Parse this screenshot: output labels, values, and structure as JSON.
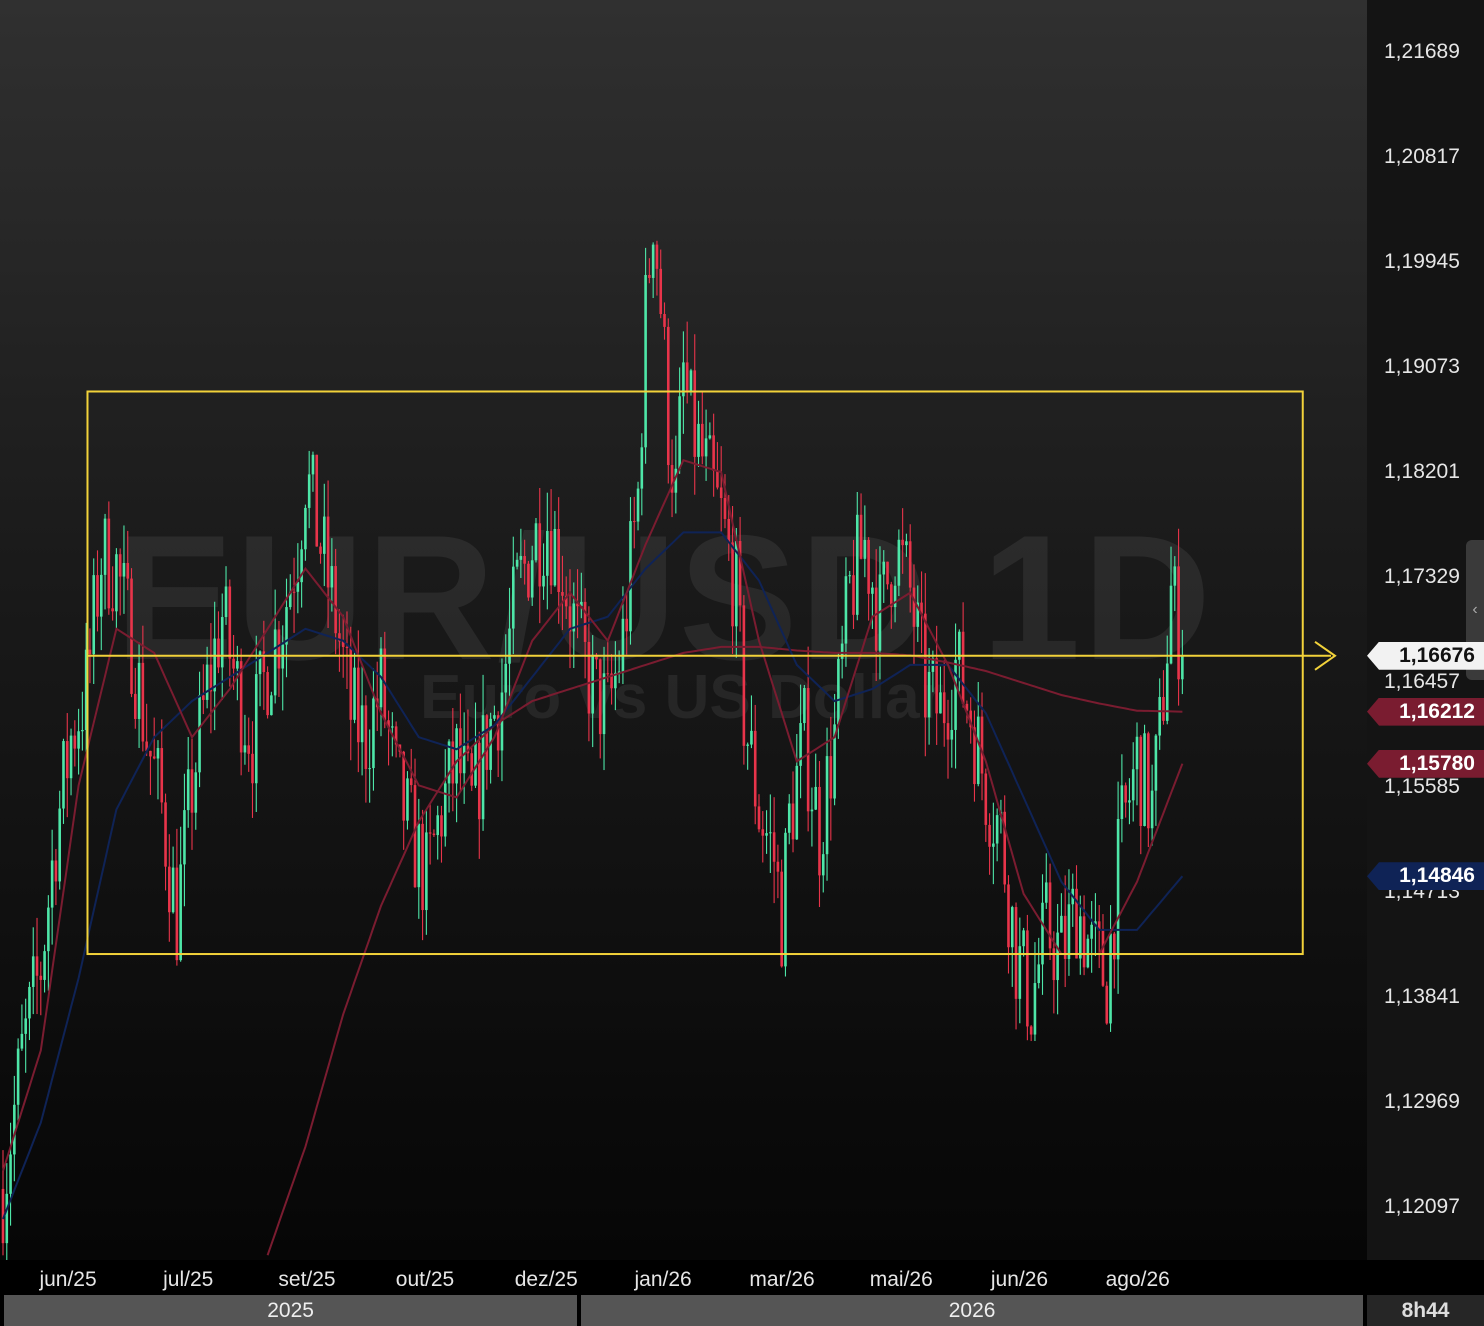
{
  "watermark": {
    "symbol": "EUR/USD 1D",
    "description": "Euro vs US Dollar"
  },
  "clock": "8h44",
  "colors": {
    "up": "#4ee6a8",
    "down": "#e8344a",
    "ma_fast": "#7a1c30",
    "ma_mid": "#0f2356",
    "ma_slow": "#7a1c30",
    "rectangle": "#f2d23a"
  },
  "chart_data": {
    "type": "candlestick",
    "timeframe": "1D",
    "ylim": [
      1.1166,
      1.2212
    ],
    "price_ticks": [
      "1,21689",
      "1,20817",
      "1,19945",
      "1,19073",
      "1,18201",
      "1,17329",
      "1,16457",
      "1,15585",
      "1,14713",
      "1,13841",
      "1,12969",
      "1,12097"
    ],
    "price_tick_values": [
      1.21689,
      1.20817,
      1.19945,
      1.19073,
      1.18201,
      1.17329,
      1.16457,
      1.15585,
      1.14713,
      1.13841,
      1.12969,
      1.12097
    ],
    "months": [
      "jun/25",
      "jul/25",
      "set/25",
      "out/25",
      "dez/25",
      "jan/26",
      "mar/26",
      "mai/26",
      "jun/26",
      "ago/26"
    ],
    "month_positions": [
      0.0498,
      0.1377,
      0.2246,
      0.3109,
      0.3996,
      0.4851,
      0.5721,
      0.6593,
      0.7458,
      0.8323
    ],
    "years": [
      "2025",
      "2026"
    ],
    "year_split_fraction": 0.4237,
    "last_price": {
      "label": "1,16676",
      "value": 1.16676
    },
    "ma_values": [
      {
        "label": "1,16212",
        "value": 1.16212,
        "style": "ma-red"
      },
      {
        "label": "1,15780",
        "value": 1.1578,
        "style": "ma-red"
      },
      {
        "label": "1,14846",
        "value": 1.14846,
        "style": "ma-blue"
      }
    ],
    "rectangle": {
      "time_from": 0.064,
      "time_to": 0.953,
      "price_top": 1.1887,
      "price_bottom": 1.142
    },
    "horizontal_line": {
      "price": 1.16676,
      "time_from": 0.064
    },
    "num_bars": 320,
    "candles_anchor_path": [
      [
        0,
        1.1225
      ],
      [
        5,
        1.1335
      ],
      [
        10,
        1.141
      ],
      [
        14,
        1.152
      ],
      [
        18,
        1.16
      ],
      [
        22,
        1.164
      ],
      [
        26,
        1.175
      ],
      [
        30,
        1.174
      ],
      [
        34,
        1.168
      ],
      [
        38,
        1.16
      ],
      [
        42,
        1.154
      ],
      [
        46,
        1.145
      ],
      [
        50,
        1.156
      ],
      [
        54,
        1.164
      ],
      [
        58,
        1.17
      ],
      [
        62,
        1.164
      ],
      [
        66,
        1.16
      ],
      [
        70,
        1.166
      ],
      [
        74,
        1.17
      ],
      [
        78,
        1.176
      ],
      [
        80,
        1.182
      ],
      [
        84,
        1.176
      ],
      [
        88,
        1.17
      ],
      [
        92,
        1.162
      ],
      [
        96,
        1.16
      ],
      [
        100,
        1.164
      ],
      [
        104,
        1.156
      ],
      [
        108,
        1.152
      ],
      [
        112,
        1.148
      ],
      [
        116,
        1.154
      ],
      [
        120,
        1.158
      ],
      [
        124,
        1.154
      ],
      [
        128,
        1.16
      ],
      [
        132,
        1.164
      ],
      [
        136,
        1.172
      ],
      [
        140,
        1.176
      ],
      [
        144,
        1.178
      ],
      [
        148,
        1.174
      ],
      [
        152,
        1.168
      ],
      [
        156,
        1.164
      ],
      [
        160,
        1.162
      ],
      [
        164,
        1.168
      ],
      [
        168,
        1.18
      ],
      [
        170,
        1.195
      ],
      [
        172,
        1.204
      ],
      [
        174,
        1.196
      ],
      [
        176,
        1.186
      ],
      [
        178,
        1.18
      ],
      [
        180,
        1.19
      ],
      [
        182,
        1.186
      ],
      [
        186,
        1.182
      ],
      [
        190,
        1.178
      ],
      [
        194,
        1.172
      ],
      [
        196,
        1.162
      ],
      [
        200,
        1.154
      ],
      [
        204,
        1.15
      ],
      [
        206,
        1.145
      ],
      [
        208,
        1.153
      ],
      [
        212,
        1.16
      ],
      [
        216,
        1.152
      ],
      [
        220,
        1.16
      ],
      [
        224,
        1.172
      ],
      [
        228,
        1.176
      ],
      [
        232,
        1.17
      ],
      [
        236,
        1.176
      ],
      [
        240,
        1.172
      ],
      [
        244,
        1.164
      ],
      [
        248,
        1.162
      ],
      [
        252,
        1.166
      ],
      [
        256,
        1.162
      ],
      [
        260,
        1.156
      ],
      [
        264,
        1.152
      ],
      [
        268,
        1.142
      ],
      [
        272,
        1.138
      ],
      [
        276,
        1.144
      ],
      [
        280,
        1.142
      ],
      [
        284,
        1.146
      ],
      [
        288,
        1.142
      ],
      [
        292,
        1.14
      ],
      [
        296,
        1.152
      ],
      [
        300,
        1.158
      ],
      [
        304,
        1.154
      ],
      [
        306,
        1.16
      ],
      [
        308,
        1.168
      ],
      [
        309,
        1.172
      ],
      [
        311,
        1.169
      ],
      [
        312,
        1.16676
      ]
    ],
    "ma_fast_path": [
      [
        0,
        1.124
      ],
      [
        10,
        1.134
      ],
      [
        20,
        1.156
      ],
      [
        30,
        1.169
      ],
      [
        40,
        1.167
      ],
      [
        50,
        1.16
      ],
      [
        60,
        1.164
      ],
      [
        70,
        1.169
      ],
      [
        80,
        1.174
      ],
      [
        90,
        1.17
      ],
      [
        100,
        1.162
      ],
      [
        110,
        1.156
      ],
      [
        120,
        1.155
      ],
      [
        130,
        1.16
      ],
      [
        140,
        1.168
      ],
      [
        150,
        1.172
      ],
      [
        160,
        1.168
      ],
      [
        170,
        1.176
      ],
      [
        180,
        1.183
      ],
      [
        190,
        1.182
      ],
      [
        200,
        1.168
      ],
      [
        210,
        1.158
      ],
      [
        220,
        1.16
      ],
      [
        230,
        1.17
      ],
      [
        240,
        1.172
      ],
      [
        250,
        1.166
      ],
      [
        260,
        1.158
      ],
      [
        270,
        1.147
      ],
      [
        280,
        1.142
      ],
      [
        290,
        1.142
      ],
      [
        300,
        1.148
      ],
      [
        312,
        1.1578
      ]
    ],
    "ma_mid_path": [
      [
        0,
        1.12
      ],
      [
        10,
        1.128
      ],
      [
        20,
        1.14
      ],
      [
        30,
        1.154
      ],
      [
        40,
        1.16
      ],
      [
        50,
        1.163
      ],
      [
        60,
        1.165
      ],
      [
        70,
        1.167
      ],
      [
        80,
        1.169
      ],
      [
        90,
        1.168
      ],
      [
        100,
        1.165
      ],
      [
        110,
        1.16
      ],
      [
        120,
        1.159
      ],
      [
        130,
        1.161
      ],
      [
        140,
        1.165
      ],
      [
        150,
        1.169
      ],
      [
        160,
        1.17
      ],
      [
        170,
        1.174
      ],
      [
        180,
        1.177
      ],
      [
        190,
        1.177
      ],
      [
        200,
        1.173
      ],
      [
        210,
        1.166
      ],
      [
        220,
        1.163
      ],
      [
        230,
        1.164
      ],
      [
        240,
        1.166
      ],
      [
        250,
        1.166
      ],
      [
        260,
        1.162
      ],
      [
        270,
        1.155
      ],
      [
        280,
        1.148
      ],
      [
        290,
        1.144
      ],
      [
        300,
        1.144
      ],
      [
        312,
        1.14846
      ]
    ],
    "ma_slow_path": [
      [
        70,
        1.117
      ],
      [
        80,
        1.126
      ],
      [
        90,
        1.137
      ],
      [
        100,
        1.146
      ],
      [
        110,
        1.153
      ],
      [
        120,
        1.158
      ],
      [
        130,
        1.161
      ],
      [
        140,
        1.163
      ],
      [
        150,
        1.164
      ],
      [
        160,
        1.165
      ],
      [
        170,
        1.166
      ],
      [
        180,
        1.167
      ],
      [
        190,
        1.1675
      ],
      [
        200,
        1.1675
      ],
      [
        210,
        1.1672
      ],
      [
        220,
        1.167
      ],
      [
        230,
        1.167
      ],
      [
        240,
        1.1668
      ],
      [
        250,
        1.1662
      ],
      [
        260,
        1.1655
      ],
      [
        270,
        1.1645
      ],
      [
        280,
        1.1635
      ],
      [
        290,
        1.1628
      ],
      [
        300,
        1.1622
      ],
      [
        312,
        1.16212
      ]
    ]
  }
}
